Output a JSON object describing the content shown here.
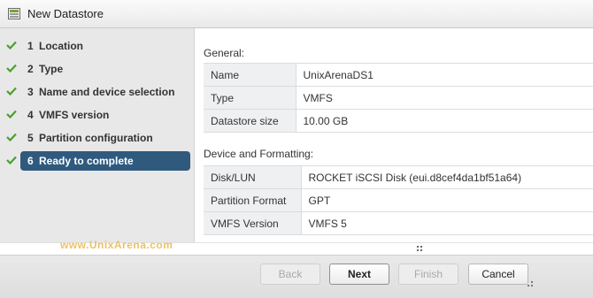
{
  "window": {
    "title": "New Datastore"
  },
  "steps": [
    {
      "num": "1",
      "label": "Location",
      "state": "done"
    },
    {
      "num": "2",
      "label": "Type",
      "state": "done"
    },
    {
      "num": "3",
      "label": "Name and device selection",
      "state": "done"
    },
    {
      "num": "4",
      "label": "VMFS version",
      "state": "done"
    },
    {
      "num": "5",
      "label": "Partition configuration",
      "state": "done"
    },
    {
      "num": "6",
      "label": "Ready to complete",
      "state": "active"
    }
  ],
  "general": {
    "heading": "General:",
    "rows": [
      {
        "key": "Name",
        "value": "UnixArenaDS1"
      },
      {
        "key": "Type",
        "value": "VMFS"
      },
      {
        "key": "Datastore size",
        "value": "10.00 GB"
      }
    ]
  },
  "device": {
    "heading": "Device and Formatting:",
    "rows": [
      {
        "key": "Disk/LUN",
        "value": "ROCKET iSCSI Disk (eui.d8cef4da1bf51a64)"
      },
      {
        "key": "Partition Format",
        "value": "GPT"
      },
      {
        "key": "VMFS Version",
        "value": "VMFS 5"
      }
    ]
  },
  "watermark": "www.UnixArena.com",
  "buttons": {
    "back": "Back",
    "next": "Next",
    "finish": "Finish",
    "cancel": "Cancel"
  },
  "colors": {
    "check": "#4aa02c",
    "active_step": "#2f5a7e"
  }
}
